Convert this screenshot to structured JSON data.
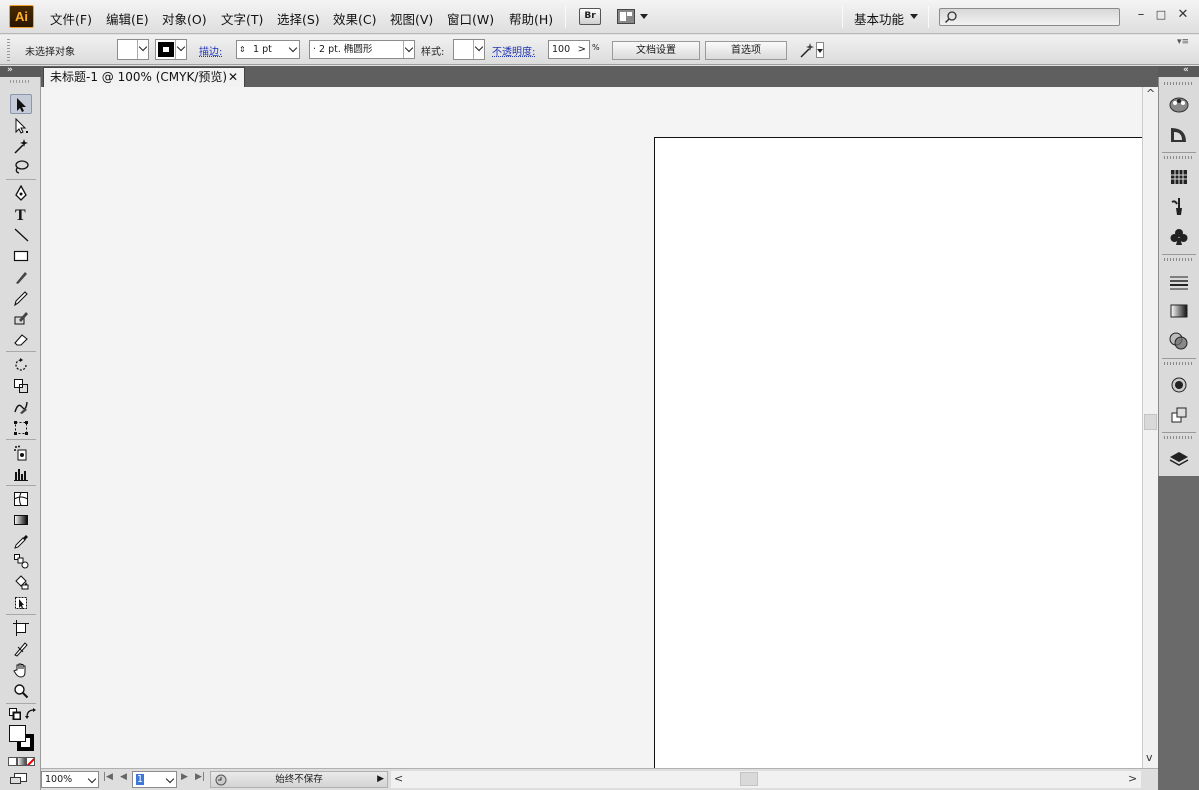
{
  "app": {
    "logo": "Ai"
  },
  "menu": [
    "文件(F)",
    "编辑(E)",
    "对象(O)",
    "文字(T)",
    "选择(S)",
    "效果(C)",
    "视图(V)",
    "窗口(W)",
    "帮助(H)"
  ],
  "bridge_label": "Br",
  "workspace": {
    "label": "基本功能"
  },
  "search": {
    "icon": "search-icon",
    "value": ""
  },
  "window_controls": {
    "minimize": "–",
    "maximize": "□",
    "close": "✕"
  },
  "control_bar": {
    "selection_status": "未选择对象",
    "stroke_link": "描边:",
    "stroke_weight": "1 pt",
    "brush_profile": "· 2 pt. 椭圆形",
    "style_label": "样式:",
    "opacity_link": "不透明度:",
    "opacity_value": "100",
    "opacity_unit": "%",
    "doc_setup_button": "文档设置",
    "preferences_button": "首选项"
  },
  "document_tab": {
    "title": "未标题-1 @ 100% (CMYK/预览)",
    "close": "✕"
  },
  "status_bar": {
    "zoom": "100%",
    "artboard_number": "1",
    "status_text": "始终不保存"
  },
  "colors": {
    "canvas": "#f4f4f4",
    "artboard": "#ffffff",
    "logo_bg": "#3a1f00",
    "logo_fg": "#ffb030",
    "link": "#2035b8"
  }
}
